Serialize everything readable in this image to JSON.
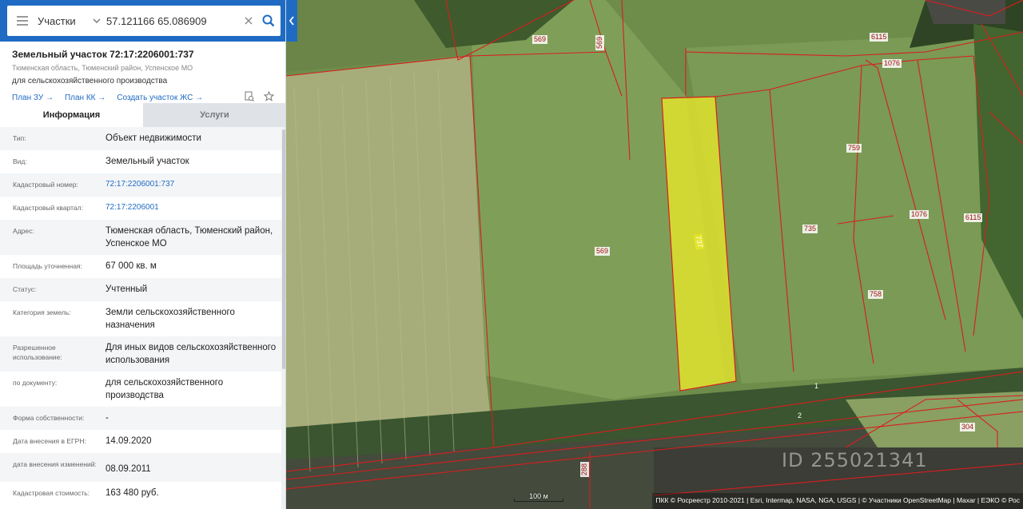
{
  "search": {
    "layer": "Участки",
    "query": "57.121166 65.086909"
  },
  "object": {
    "title": "Земельный участок 72:17:2206001:737",
    "address_short": "Тюменская область, Тюменский район, Успенское МО",
    "purpose": "для сельскохозяйственного производства",
    "links": [
      "План ЗУ",
      "План КК",
      "Создать участок ЖС"
    ]
  },
  "tabs": [
    "Информация",
    "Услуги"
  ],
  "info_rows": [
    {
      "k": "Тип:",
      "v": "Объект недвижимости"
    },
    {
      "k": "Вид:",
      "v": "Земельный участок"
    },
    {
      "k": "Кадастровый номер:",
      "v": "72:17:2206001:737"
    },
    {
      "k": "Кадастровый квартал:",
      "v": "72:17:2206001"
    },
    {
      "k": "Адрес:",
      "v": "Тюменская область, Тюменский район, Успенское МО"
    },
    {
      "k": "Площадь уточненная:",
      "v": "67 000 кв. м"
    },
    {
      "k": "Статус:",
      "v": "Учтенный"
    },
    {
      "k": "Категория земель:",
      "v": "Земли сельскохозяйственного назначения"
    },
    {
      "k": "Разрешенное использование:",
      "v": "Для иных видов сельскохозяйственного использования"
    },
    {
      "k": "по документу:",
      "v": "для сельскохозяйственного производства"
    },
    {
      "k": "Форма собственности:",
      "v": "-"
    },
    {
      "k": "Дата внесения в ЕГРН:",
      "v": "14.09.2020"
    },
    {
      "k": "дата внесения изменений:",
      "v": "08.09.2011"
    },
    {
      "k": "Кадастровая стоимость:",
      "v": "163 480 руб."
    }
  ],
  "map": {
    "parcel_labels": [
      "569",
      "569",
      "569",
      "6115",
      "1076",
      "759",
      "1076",
      "6115",
      "735",
      "737",
      "758",
      "1",
      "2",
      "304",
      "288"
    ],
    "watermark": "ID 255021341",
    "scale": "100 м",
    "attribution": "ПКК © Росреестр 2010-2021 | Esri, Intermap, NASA, NGA, USGS | © Участники OpenStreetMap | Maxar | ЕЭКО © Рос",
    "highlight_color": "#e6e62a",
    "boundary_color": "#d81e1e",
    "brand_color": "#1f6bc4"
  }
}
